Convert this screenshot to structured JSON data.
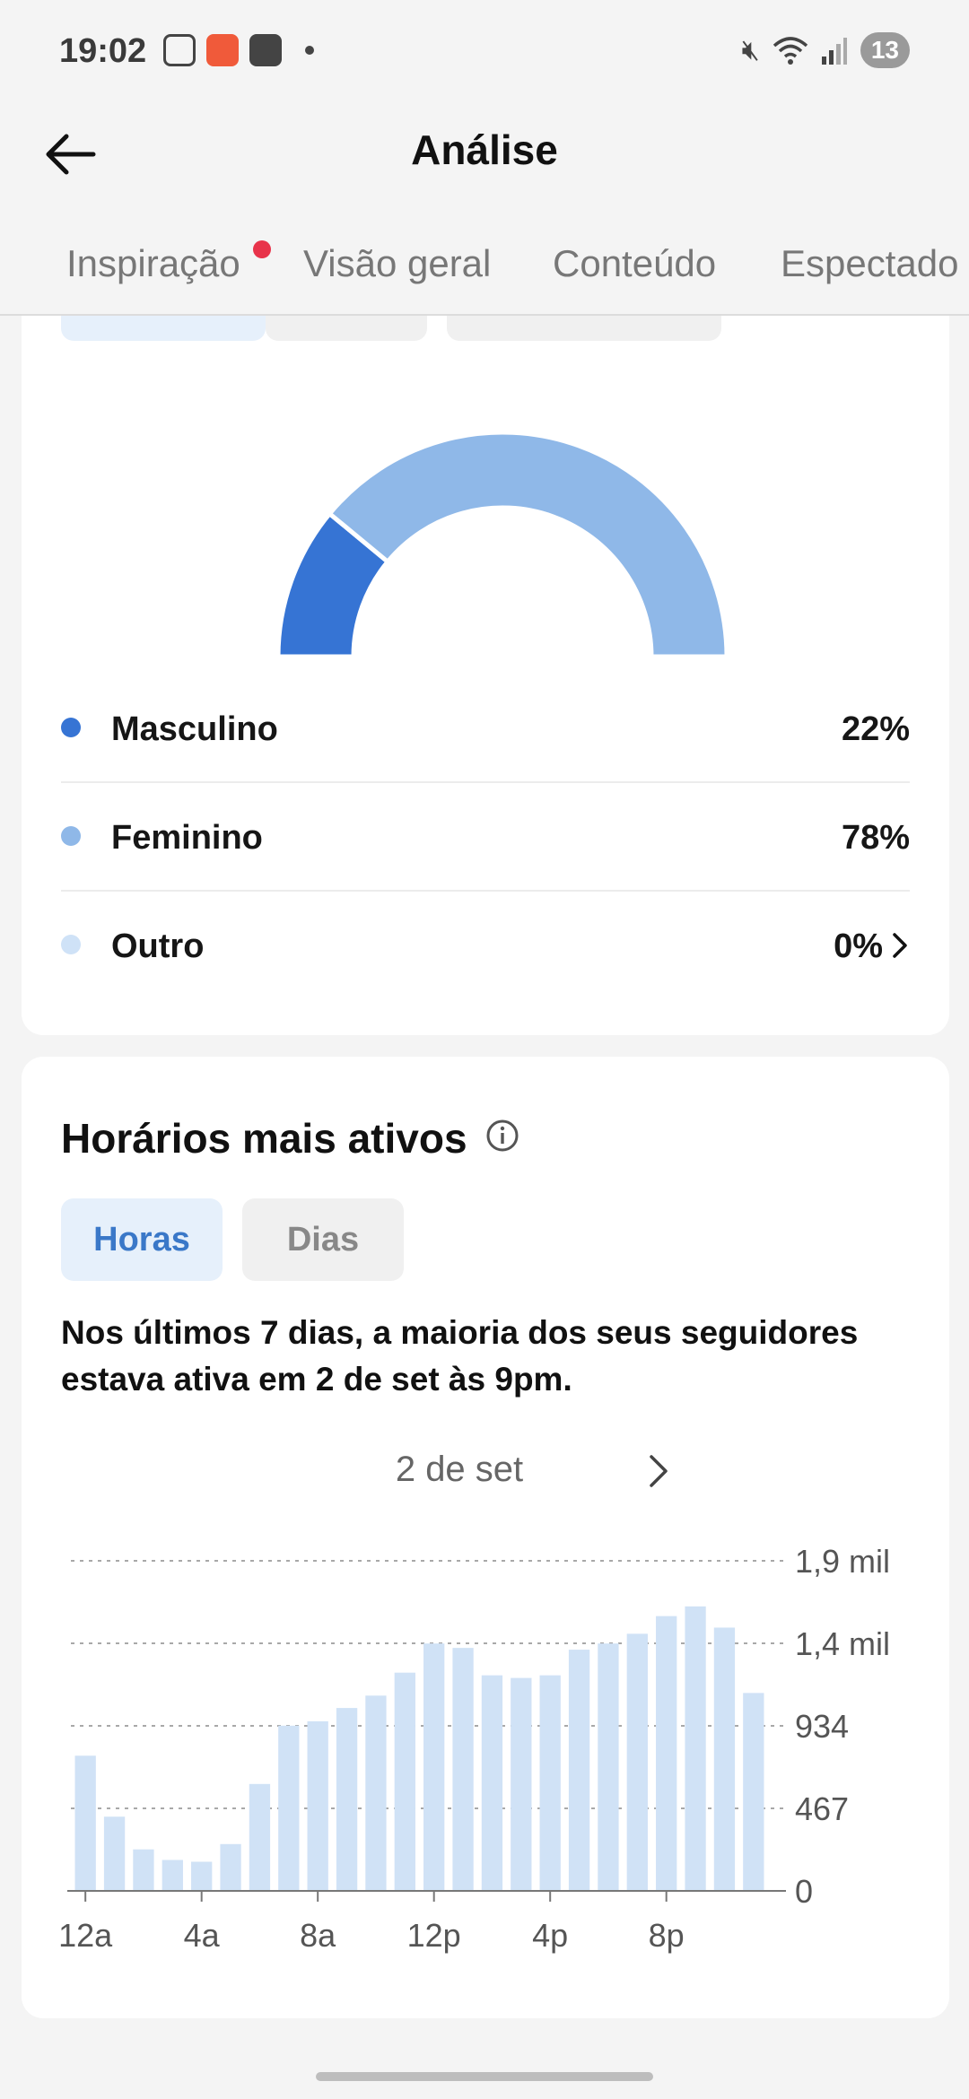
{
  "status_bar": {
    "time": "19:02",
    "icons_left": [
      "gallery-icon",
      "app-icon",
      "shopping-bag-icon"
    ],
    "icons_right": [
      "mute-icon",
      "wifi-icon",
      "signal-icon"
    ],
    "notification_count": "13"
  },
  "header": {
    "title": "Análise",
    "back_icon": "arrow-left-icon"
  },
  "tabs": [
    {
      "label": "Inspiração",
      "has_dot": true
    },
    {
      "label": "Visão geral",
      "has_dot": false
    },
    {
      "label": "Conteúdo",
      "has_dot": false
    },
    {
      "label": "Espectado",
      "has_dot": false
    }
  ],
  "colors": {
    "male": "#3674d4",
    "female": "#8fb8e8",
    "other": "#cfe2f7",
    "bar": "#d0e2f6",
    "accent": "#3a78c8",
    "badge_dot": "#e8334a"
  },
  "gender": {
    "items": [
      {
        "label": "Masculino",
        "value": "22%",
        "percent": 22
      },
      {
        "label": "Feminino",
        "value": "78%",
        "percent": 78
      },
      {
        "label": "Outro",
        "value": "0%",
        "percent": 0
      }
    ]
  },
  "active_times": {
    "title": "Horários mais ativos",
    "info_icon": "info-icon",
    "toggle": {
      "hours": "Horas",
      "days": "Dias",
      "selected": "Horas"
    },
    "description": "Nos últimos 7 dias, a maioria dos seus seguidores estava ativa em 2 de set às 9pm.",
    "date_label": "2 de set",
    "next_icon": "chevron-right-icon"
  },
  "chart_data": {
    "type": "bar",
    "title": "",
    "xlabel": "",
    "ylabel": "",
    "categories": [
      "0",
      "1",
      "2",
      "3",
      "4",
      "5",
      "6",
      "7",
      "8",
      "9",
      "10",
      "11",
      "12",
      "13",
      "14",
      "15",
      "16",
      "17",
      "18",
      "19",
      "20",
      "21",
      "22",
      "23"
    ],
    "x_tick_labels": [
      {
        "at": 0,
        "label": "12a"
      },
      {
        "at": 4,
        "label": "4a"
      },
      {
        "at": 8,
        "label": "8a"
      },
      {
        "at": 12,
        "label": "12p"
      },
      {
        "at": 16,
        "label": "4p"
      },
      {
        "at": 20,
        "label": "8p"
      }
    ],
    "y_tick_labels": [
      "0",
      "467",
      "934",
      "1,4 mil",
      "1,9 mil"
    ],
    "y_ticks": [
      0,
      467,
      934,
      1401,
      1868
    ],
    "ylim": [
      0,
      1868
    ],
    "y_axis_side": "right",
    "grid": true,
    "values": [
      765,
      420,
      235,
      175,
      165,
      265,
      605,
      935,
      960,
      1035,
      1105,
      1235,
      1400,
      1375,
      1220,
      1205,
      1220,
      1365,
      1400,
      1455,
      1555,
      1610,
      1490,
      1120
    ]
  }
}
